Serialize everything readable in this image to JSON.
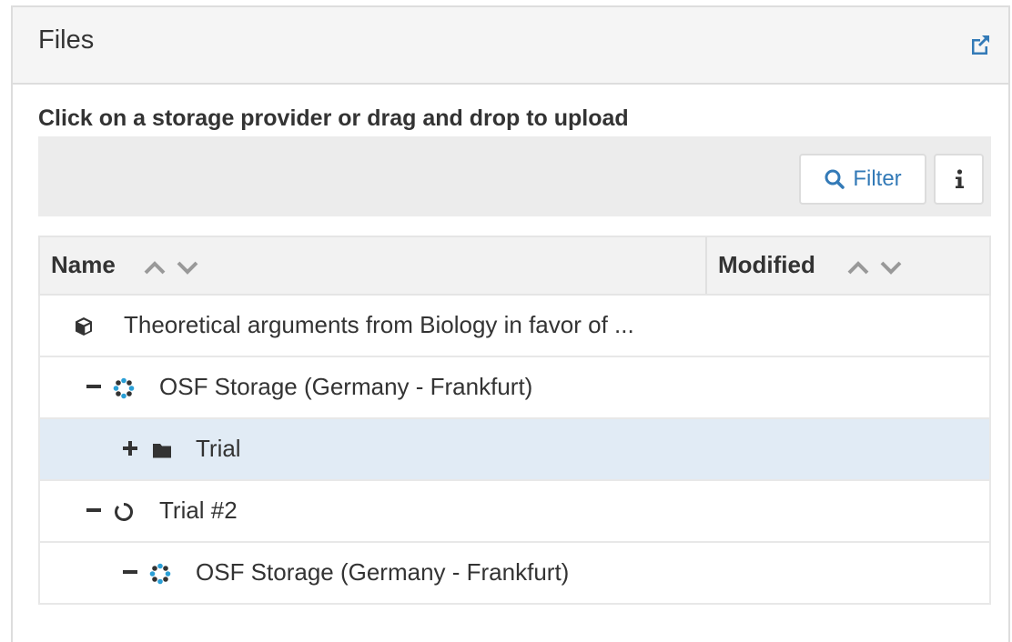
{
  "panel": {
    "title": "Files"
  },
  "instructions": "Click on a storage provider or drag and drop to upload",
  "toolbar": {
    "filter_label": "Filter",
    "info_label": "i"
  },
  "grid": {
    "columns": [
      {
        "label": "Name"
      },
      {
        "label": "Modified"
      }
    ],
    "rows": [
      {
        "name": "Theoretical arguments from Biology in favor of ...",
        "icon": "cube-icon",
        "toggle": ""
      },
      {
        "name": "OSF Storage (Germany - Frankfurt)",
        "icon": "osf-storage-icon",
        "toggle": "–"
      },
      {
        "name": "Trial",
        "icon": "folder-icon",
        "toggle": "+",
        "selected": true
      },
      {
        "name": "Trial #2",
        "icon": "circle-icon",
        "toggle": "–"
      },
      {
        "name": "OSF Storage (Germany - Frankfurt)",
        "icon": "osf-storage-icon",
        "toggle": "–"
      }
    ]
  },
  "colors": {
    "accent": "#337ab7",
    "header_bg": "#f5f5f5",
    "toolbar_bg": "#ececec",
    "selected_row": "#e1ebf5",
    "osf_icon": "#2a9fd6"
  }
}
